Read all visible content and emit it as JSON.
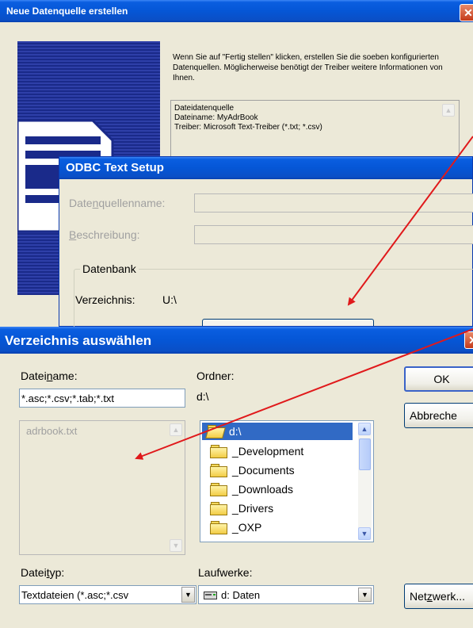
{
  "win1": {
    "title": "Neue Datenquelle erstellen",
    "intro": "Wenn Sie auf \"Fertig stellen\" klicken, erstellen Sie die soeben konfigurierten Datenquellen. Möglicherweise benötigt der Treiber weitere Informationen von Ihnen.",
    "summary": [
      "Dateidatenquelle",
      "Dateiname:  MyAdrBook",
      "Treiber:  Microsoft Text-Treiber (*.txt; *.csv)"
    ]
  },
  "win2": {
    "title": "ODBC Text Setup",
    "dsn_label": "Datenquellenname:",
    "dsn_accel": "n",
    "desc_label": "Beschreibung:",
    "desc_accel": "B",
    "group": "Datenbank",
    "dir_label": "Verzeichnis:",
    "dir_value": "U:\\"
  },
  "win3": {
    "title": "Verzeichnis auswählen",
    "filename_label_pre": "Datei",
    "filename_label_accel": "n",
    "filename_label_post": "ame:",
    "filename_value": "*.asc;*.csv;*.tab;*.txt",
    "files": [
      "adrbook.txt"
    ],
    "folder_label": "Ordner:",
    "folder_path": "d:\\",
    "folders": [
      "d:\\",
      "_Development",
      "_Documents",
      "_Downloads",
      "_Drivers",
      "_OXP"
    ],
    "filetype_label_pre": "Datei",
    "filetype_label_accel": "t",
    "filetype_label_post": "yp:",
    "filetype_value": "Textdateien (*.asc;*.csv",
    "drives_label": "Laufwerke:",
    "drive_value": "d: Daten",
    "ok": "OK",
    "cancel": "Abbreche",
    "network_pre": "Net",
    "network_accel": "z",
    "network_post": "werk..."
  },
  "colors": {
    "titlebar": "#0a5ee0",
    "arrow": "#e0191b",
    "selection": "#316ac5"
  },
  "icons": [
    "close-icon",
    "document-icon",
    "folder-icon",
    "drive-icon",
    "dropdown-arrow-icon",
    "scroll-up-icon",
    "scroll-down-icon"
  ]
}
